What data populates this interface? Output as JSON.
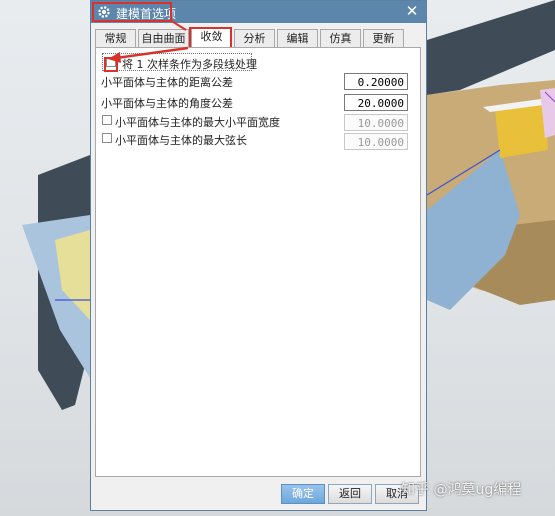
{
  "dialog": {
    "title": "建模首选项",
    "close": "✕",
    "tabs": [
      {
        "label": "常规",
        "active": false
      },
      {
        "label": "自由曲面",
        "active": false
      },
      {
        "label": "收敛",
        "active": true
      },
      {
        "label": "分析",
        "active": false
      },
      {
        "label": "编辑",
        "active": false
      },
      {
        "label": "仿真",
        "active": false
      },
      {
        "label": "更新",
        "active": false
      }
    ],
    "options": {
      "spline_as_polyline": {
        "label": "将 1 次样条作为多段线处理",
        "checked": false
      },
      "distance_tolerance": {
        "label": "小平面体与主体的距离公差",
        "value": "0.20000"
      },
      "angle_tolerance": {
        "label": "小平面体与主体的角度公差",
        "value": "20.0000"
      },
      "max_facet_width": {
        "label": "小平面体与主体的最大小平面宽度",
        "value": "10.0000",
        "checked": false
      },
      "max_chord_length": {
        "label": "小平面体与主体的最大弦长",
        "value": "10.0000",
        "checked": false
      }
    },
    "buttons": {
      "ok": "确定",
      "back": "返回",
      "cancel": "取消"
    }
  },
  "watermark": "知乎 @鸿莫ug编程",
  "colors": {
    "titlebar": "#5d86ad",
    "annotation": "#d9322c",
    "primary_button": "#6fa7dd"
  }
}
